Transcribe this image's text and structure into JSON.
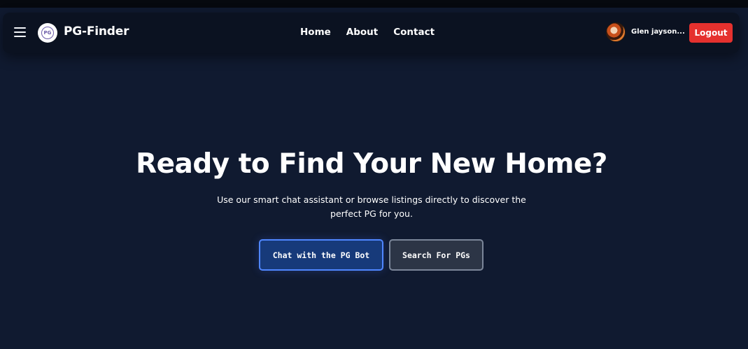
{
  "navbar": {
    "brand": "PG-Finder",
    "logo_text": "PG",
    "links": [
      {
        "label": "Home"
      },
      {
        "label": "About"
      },
      {
        "label": "Contact"
      }
    ],
    "user": {
      "name": "Glen jayson..."
    },
    "logout_label": "Logout"
  },
  "hero": {
    "title": "Ready to Find Your New Home?",
    "subtitle_line1": "Use our smart chat assistant or browse listings directly to discover the",
    "subtitle_line2": "perfect PG for you.",
    "primary_button": "Chat with the PG Bot",
    "secondary_button": "Search For PGs"
  },
  "icons": {
    "menu": "menu-icon",
    "logo": "logo-icon",
    "avatar": "avatar"
  },
  "colors": {
    "background": "#101a30",
    "navbar": "#0b1221",
    "logout": "#e5312e",
    "primary_button_border": "#4f86ff",
    "primary_button_bg": "#173a7a",
    "secondary_button_bg": "#2c3546"
  }
}
